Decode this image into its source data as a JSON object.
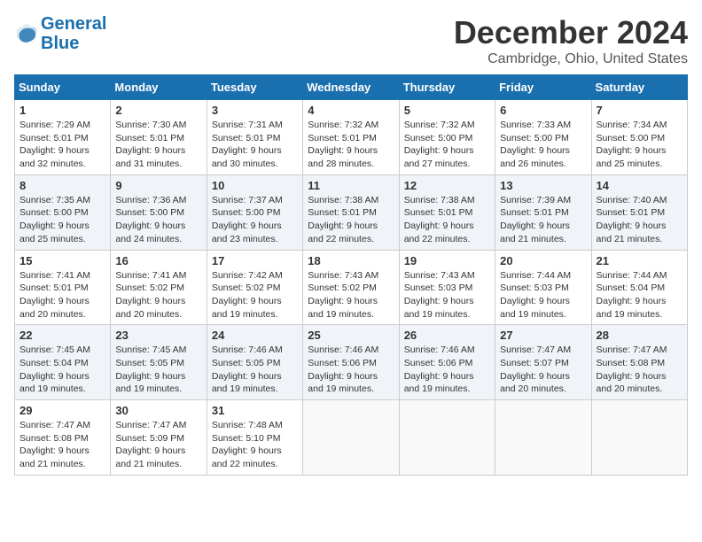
{
  "logo": {
    "line1": "General",
    "line2": "Blue"
  },
  "title": "December 2024",
  "location": "Cambridge, Ohio, United States",
  "weekdays": [
    "Sunday",
    "Monday",
    "Tuesday",
    "Wednesday",
    "Thursday",
    "Friday",
    "Saturday"
  ],
  "weeks": [
    [
      {
        "day": "1",
        "sunrise": "7:29 AM",
        "sunset": "5:01 PM",
        "daylight": "9 hours and 32 minutes."
      },
      {
        "day": "2",
        "sunrise": "7:30 AM",
        "sunset": "5:01 PM",
        "daylight": "9 hours and 31 minutes."
      },
      {
        "day": "3",
        "sunrise": "7:31 AM",
        "sunset": "5:01 PM",
        "daylight": "9 hours and 30 minutes."
      },
      {
        "day": "4",
        "sunrise": "7:32 AM",
        "sunset": "5:01 PM",
        "daylight": "9 hours and 28 minutes."
      },
      {
        "day": "5",
        "sunrise": "7:32 AM",
        "sunset": "5:00 PM",
        "daylight": "9 hours and 27 minutes."
      },
      {
        "day": "6",
        "sunrise": "7:33 AM",
        "sunset": "5:00 PM",
        "daylight": "9 hours and 26 minutes."
      },
      {
        "day": "7",
        "sunrise": "7:34 AM",
        "sunset": "5:00 PM",
        "daylight": "9 hours and 25 minutes."
      }
    ],
    [
      {
        "day": "8",
        "sunrise": "7:35 AM",
        "sunset": "5:00 PM",
        "daylight": "9 hours and 25 minutes."
      },
      {
        "day": "9",
        "sunrise": "7:36 AM",
        "sunset": "5:00 PM",
        "daylight": "9 hours and 24 minutes."
      },
      {
        "day": "10",
        "sunrise": "7:37 AM",
        "sunset": "5:00 PM",
        "daylight": "9 hours and 23 minutes."
      },
      {
        "day": "11",
        "sunrise": "7:38 AM",
        "sunset": "5:01 PM",
        "daylight": "9 hours and 22 minutes."
      },
      {
        "day": "12",
        "sunrise": "7:38 AM",
        "sunset": "5:01 PM",
        "daylight": "9 hours and 22 minutes."
      },
      {
        "day": "13",
        "sunrise": "7:39 AM",
        "sunset": "5:01 PM",
        "daylight": "9 hours and 21 minutes."
      },
      {
        "day": "14",
        "sunrise": "7:40 AM",
        "sunset": "5:01 PM",
        "daylight": "9 hours and 21 minutes."
      }
    ],
    [
      {
        "day": "15",
        "sunrise": "7:41 AM",
        "sunset": "5:01 PM",
        "daylight": "9 hours and 20 minutes."
      },
      {
        "day": "16",
        "sunrise": "7:41 AM",
        "sunset": "5:02 PM",
        "daylight": "9 hours and 20 minutes."
      },
      {
        "day": "17",
        "sunrise": "7:42 AM",
        "sunset": "5:02 PM",
        "daylight": "9 hours and 19 minutes."
      },
      {
        "day": "18",
        "sunrise": "7:43 AM",
        "sunset": "5:02 PM",
        "daylight": "9 hours and 19 minutes."
      },
      {
        "day": "19",
        "sunrise": "7:43 AM",
        "sunset": "5:03 PM",
        "daylight": "9 hours and 19 minutes."
      },
      {
        "day": "20",
        "sunrise": "7:44 AM",
        "sunset": "5:03 PM",
        "daylight": "9 hours and 19 minutes."
      },
      {
        "day": "21",
        "sunrise": "7:44 AM",
        "sunset": "5:04 PM",
        "daylight": "9 hours and 19 minutes."
      }
    ],
    [
      {
        "day": "22",
        "sunrise": "7:45 AM",
        "sunset": "5:04 PM",
        "daylight": "9 hours and 19 minutes."
      },
      {
        "day": "23",
        "sunrise": "7:45 AM",
        "sunset": "5:05 PM",
        "daylight": "9 hours and 19 minutes."
      },
      {
        "day": "24",
        "sunrise": "7:46 AM",
        "sunset": "5:05 PM",
        "daylight": "9 hours and 19 minutes."
      },
      {
        "day": "25",
        "sunrise": "7:46 AM",
        "sunset": "5:06 PM",
        "daylight": "9 hours and 19 minutes."
      },
      {
        "day": "26",
        "sunrise": "7:46 AM",
        "sunset": "5:06 PM",
        "daylight": "9 hours and 19 minutes."
      },
      {
        "day": "27",
        "sunrise": "7:47 AM",
        "sunset": "5:07 PM",
        "daylight": "9 hours and 20 minutes."
      },
      {
        "day": "28",
        "sunrise": "7:47 AM",
        "sunset": "5:08 PM",
        "daylight": "9 hours and 20 minutes."
      }
    ],
    [
      {
        "day": "29",
        "sunrise": "7:47 AM",
        "sunset": "5:08 PM",
        "daylight": "9 hours and 21 minutes."
      },
      {
        "day": "30",
        "sunrise": "7:47 AM",
        "sunset": "5:09 PM",
        "daylight": "9 hours and 21 minutes."
      },
      {
        "day": "31",
        "sunrise": "7:48 AM",
        "sunset": "5:10 PM",
        "daylight": "9 hours and 22 minutes."
      },
      null,
      null,
      null,
      null
    ]
  ],
  "labels": {
    "sunrise": "Sunrise:",
    "sunset": "Sunset:",
    "daylight": "Daylight:"
  }
}
